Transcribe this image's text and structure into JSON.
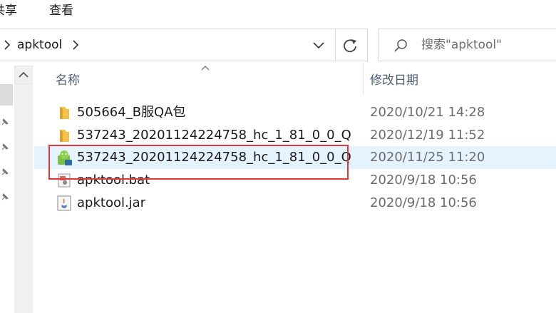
{
  "ribbon": {
    "tabs": [
      {
        "label": "共享"
      },
      {
        "label": "查看"
      }
    ]
  },
  "address_bar": {
    "path": "apktool",
    "separator_icon": "chevron-right-icon",
    "dropdown_icon": "chevron-down-icon",
    "refresh_icon": "refresh-icon"
  },
  "search": {
    "placeholder": "搜索\"apktool\"",
    "icon": "search-icon"
  },
  "columns": {
    "name": "名称",
    "date": "修改日期"
  },
  "files": [
    {
      "name": "505664_B服QA包",
      "date": "2020/10/21 14:28",
      "icon": "folder-icon",
      "selected": false
    },
    {
      "name": "537243_20201124224758_hc_1_81_0_0_Q...",
      "date": "2020/12/19 11:52",
      "icon": "folder-icon",
      "selected": false
    },
    {
      "name": "537243_20201124224758_hc_1_81_0_0_Q...",
      "date": "2020/11/25 11:20",
      "icon": "apk-android-icon",
      "selected": true
    },
    {
      "name": "apktool.bat",
      "date": "2020/9/18 10:56",
      "icon": "batch-file-icon",
      "selected": false
    },
    {
      "name": "apktool.jar",
      "date": "2020/9/18 10:56",
      "icon": "java-jar-icon",
      "selected": false
    }
  ],
  "colors": {
    "selection": "#e5f3ff",
    "highlight": "#e0383b",
    "folder": "#f2c14e",
    "header_text": "#4c607a"
  }
}
